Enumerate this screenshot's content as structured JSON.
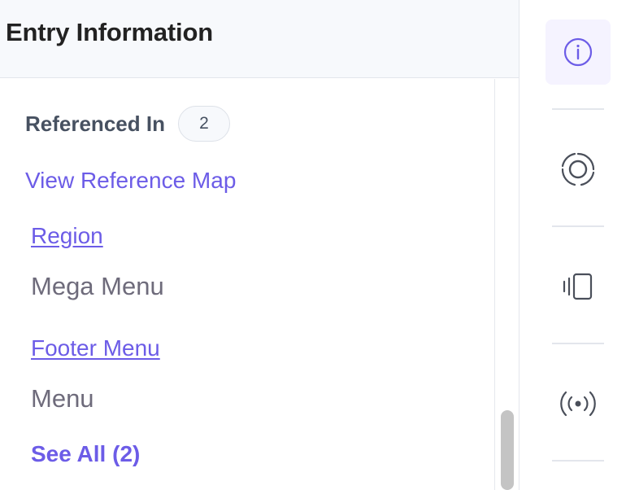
{
  "panel": {
    "title": "Entry Information"
  },
  "references": {
    "heading": "Referenced In",
    "count": "2",
    "map_link": "View Reference Map",
    "items": [
      {
        "title": "Region",
        "type": "Mega Menu"
      },
      {
        "title": "Footer Menu",
        "type": "Menu"
      }
    ],
    "see_all": "See All (2)"
  },
  "rail": {
    "items": [
      {
        "icon": "info-icon",
        "active": true
      },
      {
        "icon": "target-icon",
        "active": false
      },
      {
        "icon": "device-preview-icon",
        "active": false
      },
      {
        "icon": "broadcast-icon",
        "active": false
      }
    ]
  },
  "colors": {
    "accent": "#6c5ce7",
    "text": "#475161",
    "muted": "#6e6b7b"
  }
}
